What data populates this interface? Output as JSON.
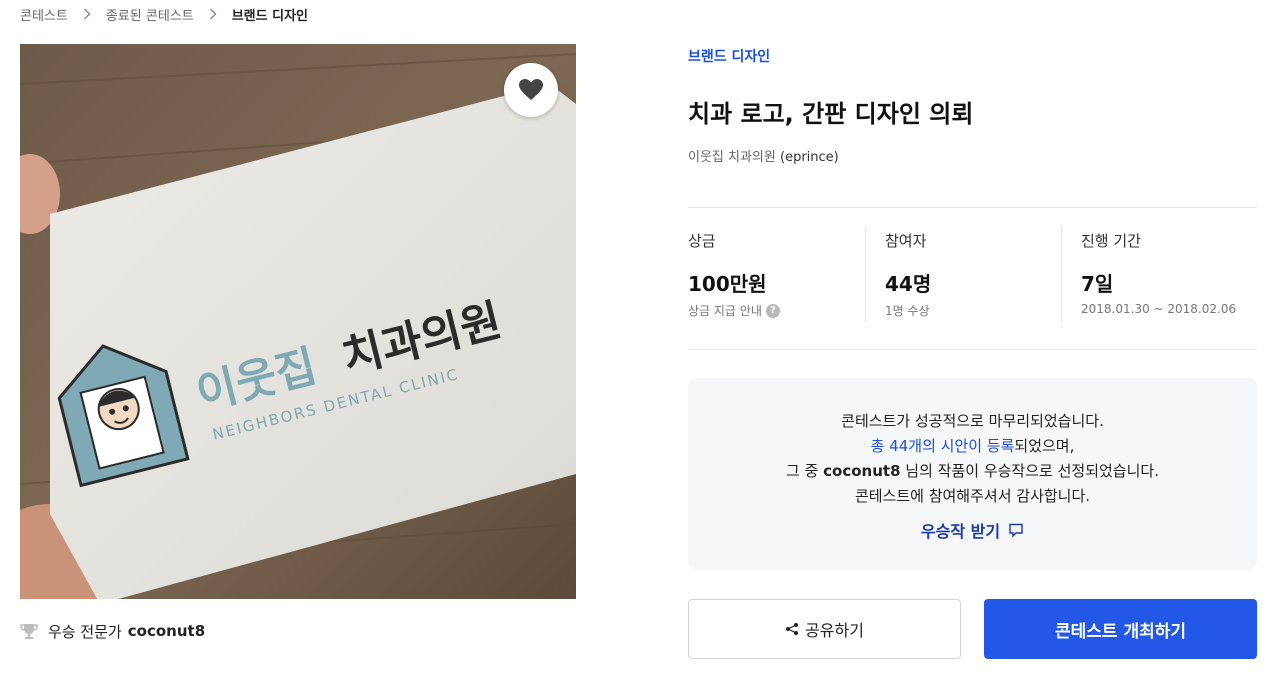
{
  "breadcrumb": [
    "콘테스트",
    "종료된 콘테스트",
    "브랜드 디자인"
  ],
  "hero": {
    "sign_korean": "이웃집",
    "sign_korean_dark": "치과의원",
    "sign_english": "NEIGHBORS DENTAL CLINIC"
  },
  "winner": {
    "label": "우승 전문가",
    "name": "coconut8"
  },
  "contest": {
    "category": "브랜드 디자인",
    "title": "치과 로고, 간판 디자인 의뢰",
    "host_name": "이웃집 치과의원",
    "host_id": "(eprince)"
  },
  "stats": [
    {
      "label": "상금",
      "value": "100만원",
      "sub": "상금 지급 안내"
    },
    {
      "label": "참여자",
      "value": "44명",
      "sub": "1명 수상"
    },
    {
      "label": "진행 기간",
      "value": "7일",
      "sub": "2018.01.30 ~ 2018.02.06"
    }
  ],
  "notice": {
    "line1": "콘테스트가 성공적으로 마무리되었습니다.",
    "line2_link": "총 44개의 시안이 등록",
    "line2_rest": "되었으며,",
    "line3_pre": "그 중 ",
    "line3_name": "coconut8",
    "line3_post": " 님의 작품이 우승작으로 선정되었습니다.",
    "line4": "콘테스트에 참여해주셔서 감사합니다.",
    "receive": "우승작 받기"
  },
  "buttons": {
    "share": "공유하기",
    "host": "콘테스트 개최하기"
  },
  "colors": {
    "accent": "#2357e8",
    "link": "#1c4ed8",
    "notice_bg": "#f6f7f9"
  }
}
